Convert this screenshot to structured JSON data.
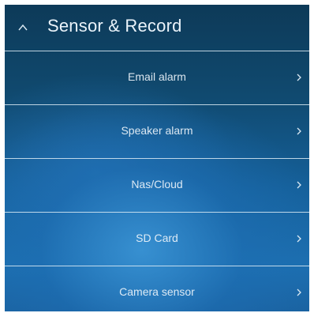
{
  "section": {
    "title": "Sensor & Record",
    "collapse_icon": "chevron-up-icon"
  },
  "menu": {
    "items": [
      {
        "label": "Email alarm",
        "icon": "chevron-right-icon"
      },
      {
        "label": "Speaker alarm",
        "icon": "chevron-right-icon"
      },
      {
        "label": "Nas/Cloud",
        "icon": "chevron-right-icon"
      },
      {
        "label": "SD Card",
        "icon": "chevron-right-icon"
      },
      {
        "label": "Camera sensor",
        "icon": "chevron-right-icon"
      }
    ]
  },
  "colors": {
    "background_top": "#0d3a58",
    "background_bottom": "#1c6fb0",
    "text": "#eaf3fa",
    "divider": "#dcebf5"
  }
}
